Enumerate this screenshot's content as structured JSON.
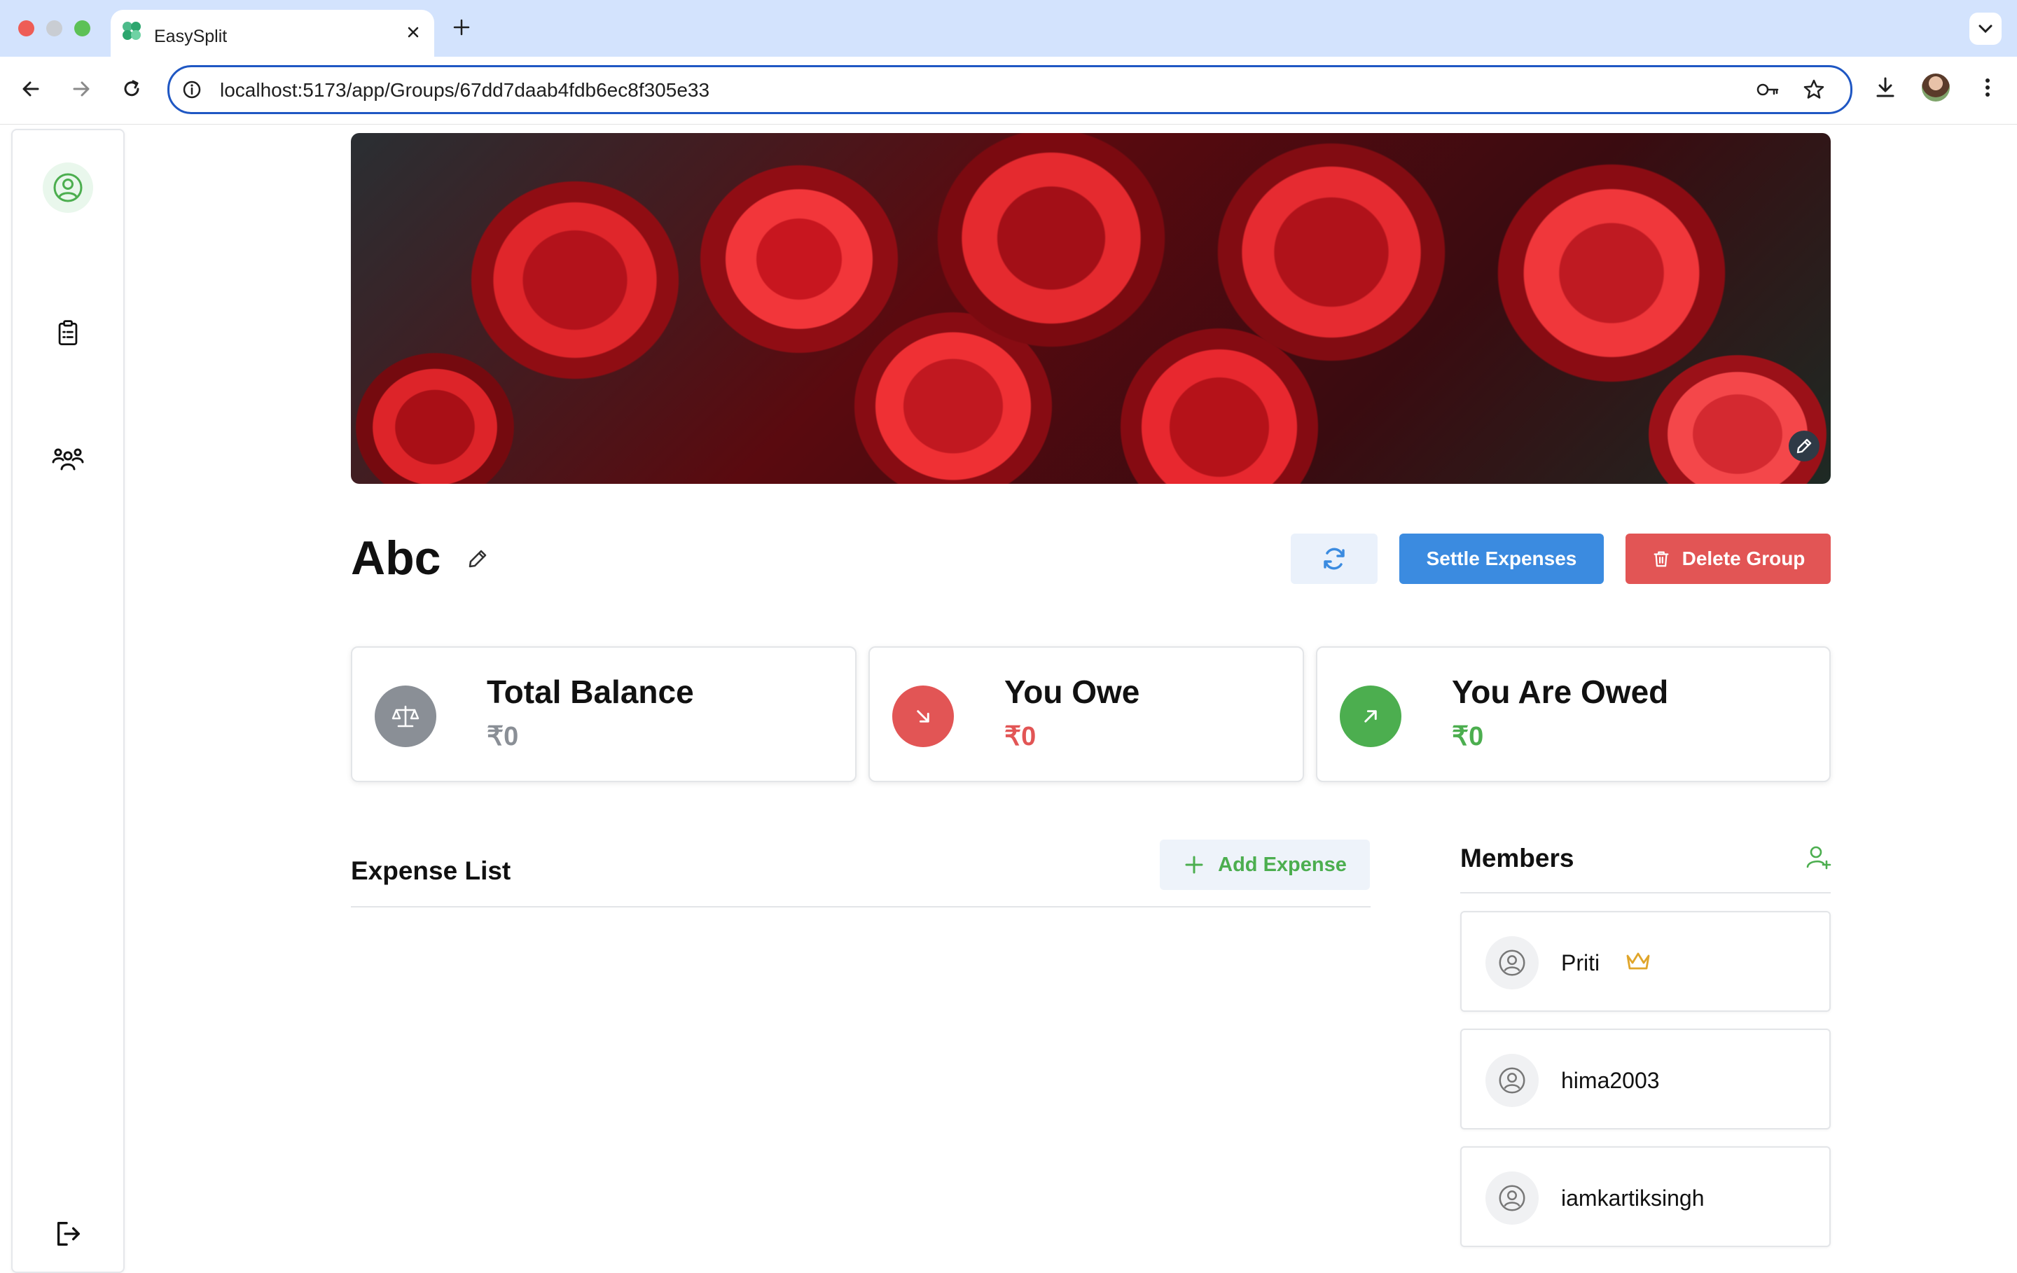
{
  "browser": {
    "tab_title": "EasySplit",
    "url": "localhost:5173/app/Groups/67dd7daab4fdb6ec8f305e33"
  },
  "sidebar": {
    "items": [
      {
        "icon": "user-circle-icon",
        "label": "Profile"
      },
      {
        "icon": "clipboard-list-icon",
        "label": "Expenses"
      },
      {
        "icon": "users-icon",
        "label": "Groups"
      },
      {
        "icon": "logout-icon",
        "label": "Logout"
      }
    ]
  },
  "group": {
    "name": "Abc"
  },
  "actions": {
    "refresh_icon": "refresh-icon",
    "settle_label": "Settle Expenses",
    "delete_label": "Delete Group"
  },
  "summary": {
    "total_balance": {
      "label": "Total Balance",
      "value": "₹0",
      "color": "#8a8f96"
    },
    "you_owe": {
      "label": "You Owe",
      "value": "₹0",
      "color": "#e25555"
    },
    "you_are_owed": {
      "label": "You Are Owed",
      "value": "₹0",
      "color": "#4cae4f"
    }
  },
  "expenses": {
    "title": "Expense List",
    "add_label": "Add Expense",
    "items": []
  },
  "members": {
    "title": "Members",
    "list": [
      {
        "name": "Priti",
        "is_admin": true
      },
      {
        "name": "hima2003",
        "is_admin": false
      },
      {
        "name": "iamkartiksingh",
        "is_admin": false
      }
    ]
  },
  "colors": {
    "accent_blue": "#3b8be0",
    "danger_red": "#e25555",
    "success_green": "#4cae4f"
  }
}
